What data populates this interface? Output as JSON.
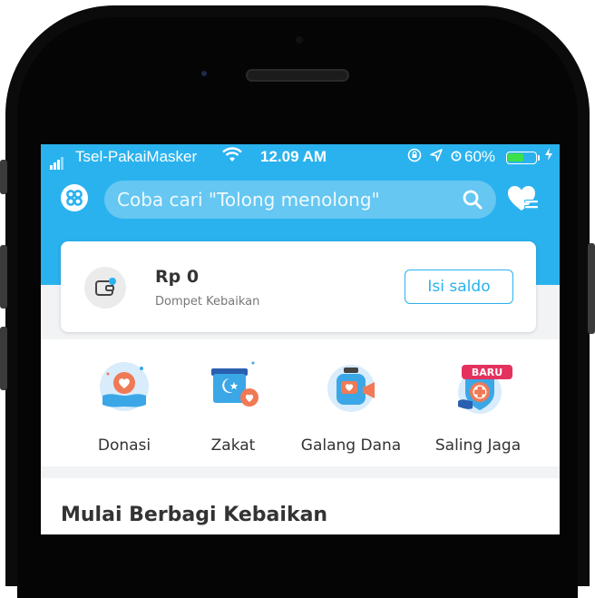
{
  "status_bar": {
    "carrier": "Tsel-PakaiMasker",
    "time": "12.09 AM",
    "battery_percent": "60%",
    "battery_level": 0.6,
    "icons": [
      "signal-icon",
      "wifi-icon",
      "lock-rotation-icon",
      "location-icon",
      "alarm-icon",
      "battery-icon",
      "charging-icon"
    ]
  },
  "header": {
    "logo_icon": "kitabisa-logo-icon",
    "search_placeholder": "Coba cari \"Tolong menolong\"",
    "search_icon": "search-icon",
    "favorite_icon": "heart-list-icon"
  },
  "wallet": {
    "amount": "Rp 0",
    "label": "Dompet Kebaikan",
    "topup_label": "Isi saldo"
  },
  "features": [
    {
      "label": "Donasi",
      "icon": "donation-hand-icon"
    },
    {
      "label": "Zakat",
      "icon": "zakat-box-icon"
    },
    {
      "label": "Galang Dana",
      "icon": "fundraise-jar-icon"
    },
    {
      "label": "Saling Jaga",
      "icon": "health-shield-icon",
      "badge": "BARU"
    }
  ],
  "section": {
    "title": "Mulai Berbagi Kebaikan"
  },
  "colors": {
    "primary": "#2ab2ee",
    "badge": "#e5315e",
    "battery": "#3ce04a"
  }
}
